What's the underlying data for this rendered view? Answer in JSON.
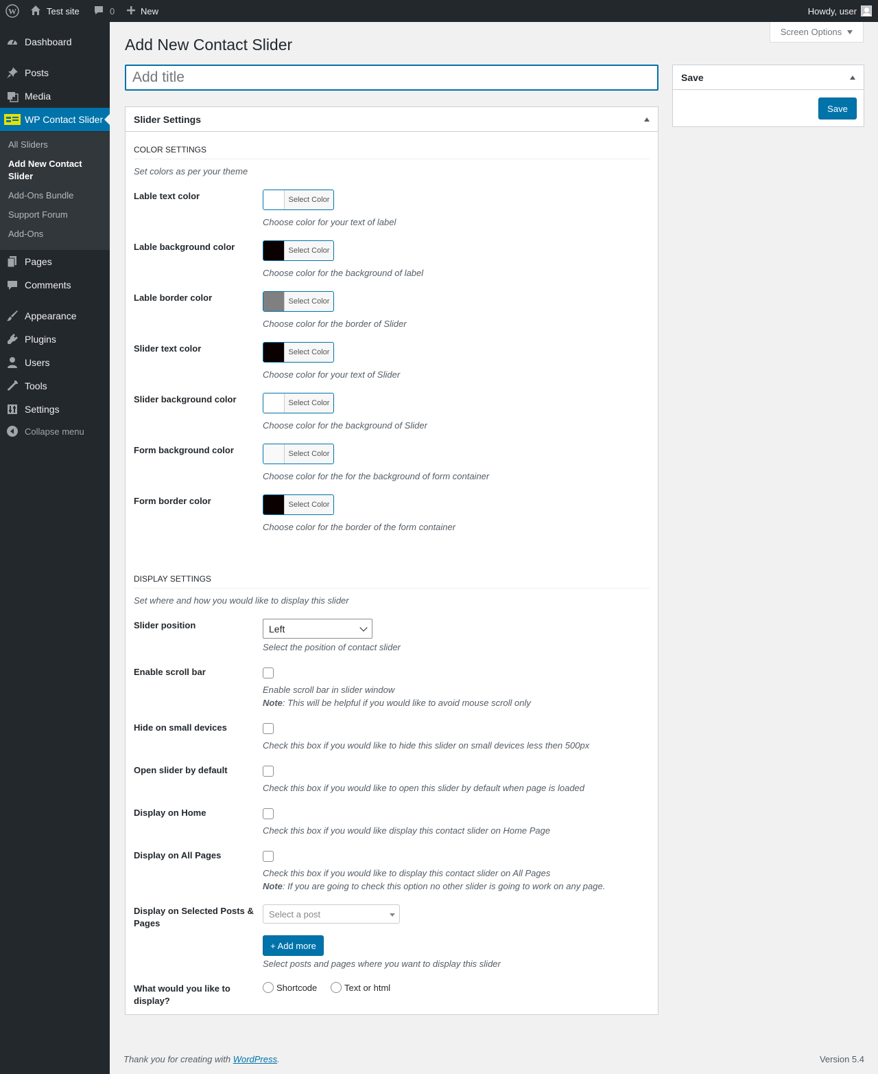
{
  "admin_bar": {
    "site_name": "Test site",
    "comments_count": "0",
    "new_label": "New",
    "greeting": "Howdy, user"
  },
  "menu": {
    "items": [
      {
        "label": "Dashboard",
        "icon": "dashboard-icon"
      },
      {
        "label": "Posts",
        "icon": "pushpin-icon"
      },
      {
        "label": "Media",
        "icon": "media-icon"
      },
      {
        "label": "WP Contact Slider",
        "icon": "contact-slider-icon"
      },
      {
        "label": "Pages",
        "icon": "page-icon"
      },
      {
        "label": "Comments",
        "icon": "comment-icon"
      },
      {
        "label": "Appearance",
        "icon": "brush-icon"
      },
      {
        "label": "Plugins",
        "icon": "plugin-icon"
      },
      {
        "label": "Users",
        "icon": "user-icon"
      },
      {
        "label": "Tools",
        "icon": "wrench-icon"
      },
      {
        "label": "Settings",
        "icon": "settings-icon"
      }
    ],
    "submenu": [
      "All Sliders",
      "Add New Contact Slider",
      "Add-Ons Bundle",
      "Support Forum",
      "Add-Ons"
    ],
    "collapse_label": "Collapse menu"
  },
  "header": {
    "screen_options": "Screen Options",
    "page_title": "Add New Contact Slider",
    "title_placeholder": "Add title"
  },
  "save_box": {
    "title": "Save",
    "button": "Save"
  },
  "settings": {
    "box_title": "Slider Settings",
    "color_section": {
      "title": "COLOR SETTINGS",
      "desc": "Set colors as per your theme",
      "button_label": "Select Color",
      "rows": [
        {
          "label": "Lable text color",
          "color": "#ffffff",
          "help": "Choose color for your text of label"
        },
        {
          "label": "Lable background color",
          "color": "#0b0000",
          "help": "Choose color for the background of label"
        },
        {
          "label": "Lable border color",
          "color": "#808080",
          "help": "Choose color for the border of Slider"
        },
        {
          "label": "Slider text color",
          "color": "#0b0000",
          "help": "Choose color for your text of Slider"
        },
        {
          "label": "Slider background color",
          "color": "#ffffff",
          "help": "Choose color for the background of Slider"
        },
        {
          "label": "Form background color",
          "color": "#f9f9f9",
          "help": "Choose color for the for the background of form container"
        },
        {
          "label": "Form border color",
          "color": "#0b0000",
          "help": "Choose color for the border of the form container"
        }
      ]
    },
    "display_section": {
      "title": "DISPLAY SETTINGS",
      "desc": "Set where and how you would like to display this slider",
      "slider_position": {
        "label": "Slider position",
        "value": "Left",
        "help": "Select the position of contact slider"
      },
      "scroll_bar": {
        "label": "Enable scroll bar",
        "help": "Enable scroll bar in slider window",
        "note_bold": "Note",
        "note": ": This will be helpful if you would like to avoid mouse scroll only"
      },
      "hide_small": {
        "label": "Hide on small devices",
        "help": "Check this box if you would like to hide this slider on small devices less then 500px"
      },
      "open_default": {
        "label": "Open slider by default",
        "help": "Check this box if you would like to open this slider by default when page is loaded"
      },
      "display_home": {
        "label": "Display on Home",
        "help": "Check this box if you would like display this contact slider on Home Page"
      },
      "display_all": {
        "label": "Display on All Pages",
        "help": "Check this box if you would like to display this contact slider on All Pages",
        "note_bold": "Note",
        "note": ": If you are going to check this option no other slider is going to work on any page."
      },
      "display_selected": {
        "label": "Display on Selected Posts & Pages",
        "placeholder": "Select a post",
        "add_more": "+ Add more",
        "help": "Select posts and pages where you want to display this slider"
      },
      "display_what": {
        "label": "What would you like to display?",
        "options": [
          "Shortcode",
          "Text or html"
        ]
      }
    }
  },
  "footer": {
    "text_before": "Thank you for creating with ",
    "link": "WordPress",
    "text_after": ".",
    "version": "Version 5.4"
  }
}
